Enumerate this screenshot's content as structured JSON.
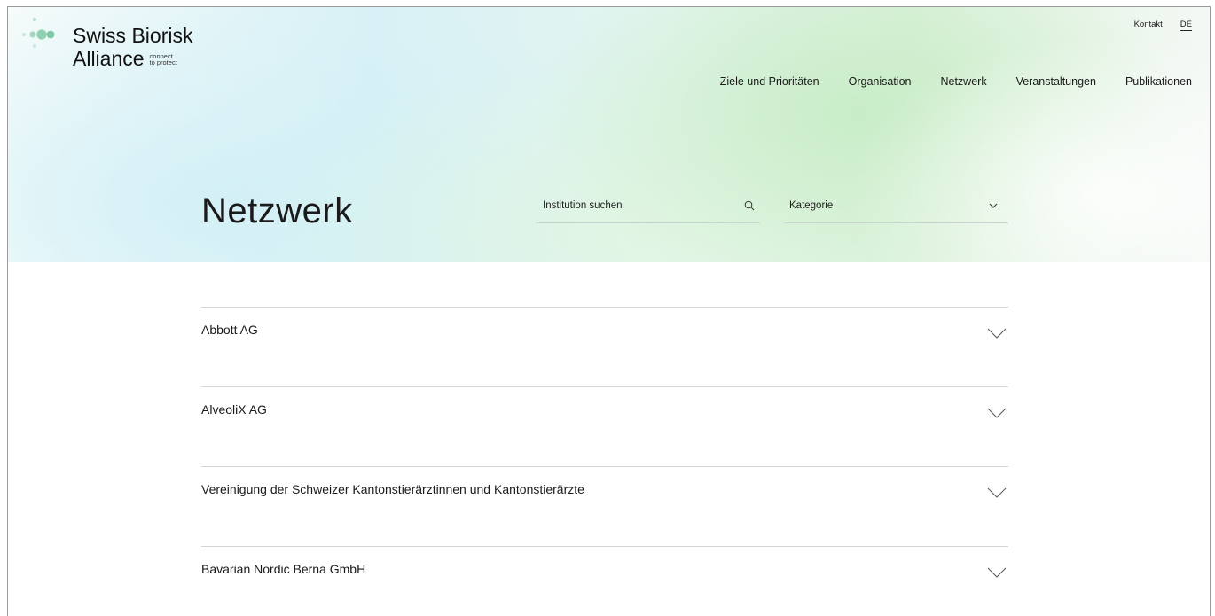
{
  "brand": {
    "name_line1": "Swiss Biorisk",
    "name_line2": "Alliance",
    "tagline_line1": "connect",
    "tagline_line2": "to protect",
    "accent_color": "#7fc9a6"
  },
  "utility_nav": {
    "contact": "Kontakt",
    "language": "DE"
  },
  "main_nav": [
    "Ziele und Prioritäten",
    "Organisation",
    "Netzwerk",
    "Veranstaltungen",
    "Publikationen"
  ],
  "page": {
    "title": "Netzwerk"
  },
  "filters": {
    "search_placeholder": "Institution suchen",
    "search_icon": "search-icon",
    "category_selected": "Kategorie",
    "category_icon": "chevron-down-icon"
  },
  "institutions": [
    {
      "name": "Abbott AG"
    },
    {
      "name": "AlveoliX AG"
    },
    {
      "name": "Vereinigung der Schweizer Kantonstierärztinnen und Kantonstierärzte"
    },
    {
      "name": "Bavarian Nordic Berna GmbH"
    }
  ]
}
